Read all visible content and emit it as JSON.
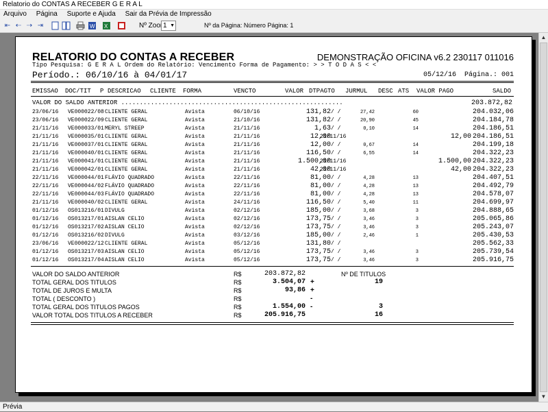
{
  "window": {
    "title": "Relatorio do CONTAS A RECEBER G E R A L"
  },
  "menu": [
    "Arquivo",
    "Página",
    "Suporte e Ajuda",
    "Sair da Prévia de Impressão"
  ],
  "toolbar": {
    "zoom_label": "Nº Zoom",
    "zoom_value": "1",
    "page_label": "Nº da Página: Número Página: 1",
    "icons": [
      "first-page-icon",
      "prev-page-icon",
      "next-page-icon",
      "last-page-icon",
      "single-page-icon",
      "two-pages-icon",
      "print-icon",
      "word-export-icon",
      "excel-export-icon",
      "pdf-export-icon"
    ]
  },
  "status": {
    "text": "Prévia"
  },
  "report": {
    "title": "RELATORIO DO CONTAS A RECEBER",
    "version": "DEMONSTRAÇÃO OFICINA v6.2 230117 011016",
    "filter": "Tipo Pesquisa: G E R A L   Ordem do Relatório: Vencimento  Forma de Pagamento: > > T O D A S < <",
    "periodo": "Período.: 06/10/16 à 04/01/17",
    "date": "05/12/16",
    "page": "Página.: 001",
    "columns": {
      "emissao": "EMISSAO",
      "doc": "DOC/TIT",
      "p": "P",
      "descricao": "DESCRICAO",
      "cliente": "CLIENTE",
      "forma": "FORMA",
      "vencto": "VENCTO",
      "valor": "VALOR",
      "dtpagto": "DTPAGTO",
      "jurmul": "JURMUL",
      "desc": "DESC",
      "ats": "ATS",
      "valor_pago": "VALOR PAGO",
      "saldo": "SALDO"
    },
    "saldo_anterior_label": "VALOR DO SALDO ANTERIOR ............................................................",
    "saldo_anterior_value": "203.872,82",
    "rows": [
      {
        "em": "23/06/16",
        "doc": "VE000022/08",
        "cli": "CLIENTE GERAL",
        "forma": "Avista",
        "venc": "06/10/16",
        "valor": "131,82",
        "dt": "/  /",
        "jur": "27,42",
        "ats": "60",
        "pago": "",
        "saldo": "204.032,06"
      },
      {
        "em": "23/06/16",
        "doc": "VE000022/09",
        "cli": "CLIENTE GERAL",
        "forma": "Avista",
        "venc": "21/10/16",
        "valor": "131,82",
        "dt": "/  /",
        "jur": "20,90",
        "ats": "45",
        "pago": "",
        "saldo": "204.184,78"
      },
      {
        "em": "21/11/16",
        "doc": "VE000033/01",
        "cli": "MERYL STREEP",
        "forma": "Avista",
        "venc": "21/11/16",
        "valor": "1,63",
        "dt": "/  /",
        "jur": "0,10",
        "ats": "14",
        "pago": "",
        "saldo": "204.186,51"
      },
      {
        "em": "21/11/16",
        "doc": "VE000035/01",
        "cli": "CLIENTE GERAL",
        "forma": "Avista",
        "venc": "21/11/16",
        "valor": "12,00",
        "dt": "21/11/16",
        "jur": "",
        "ats": "",
        "pago": "12,00",
        "saldo": "204.186,51"
      },
      {
        "em": "21/11/16",
        "doc": "VE000037/01",
        "cli": "CLIENTE GERAL",
        "forma": "Avista",
        "venc": "21/11/16",
        "valor": "12,00",
        "dt": "/  /",
        "jur": "0,67",
        "ats": "14",
        "pago": "",
        "saldo": "204.199,18"
      },
      {
        "em": "21/11/16",
        "doc": "VE000040/01",
        "cli": "CLIENTE GERAL",
        "forma": "Avista",
        "venc": "21/11/16",
        "valor": "116,50",
        "dt": "/  /",
        "jur": "6,55",
        "ats": "14",
        "pago": "",
        "saldo": "204.322,23"
      },
      {
        "em": "21/11/16",
        "doc": "VE000041/01",
        "cli": "CLIENTE GERAL",
        "forma": "Avista",
        "venc": "21/11/16",
        "valor": "1.500,00",
        "dt": "21/11/16",
        "jur": "",
        "ats": "",
        "pago": "1.500,00",
        "saldo": "204.322,23"
      },
      {
        "em": "21/11/16",
        "doc": "VE000042/01",
        "cli": "CLIENTE GERAL",
        "forma": "Avista",
        "venc": "21/11/16",
        "valor": "42,00",
        "dt": "21/11/16",
        "jur": "",
        "ats": "",
        "pago": "42,00",
        "saldo": "204.322,23"
      },
      {
        "em": "22/11/16",
        "doc": "VE000044/01",
        "cli": "FLÁVIO QUADRADO",
        "forma": "Avista",
        "venc": "22/11/16",
        "valor": "81,00",
        "dt": "/  /",
        "jur": "4,28",
        "ats": "13",
        "pago": "",
        "saldo": "204.407,51"
      },
      {
        "em": "22/11/16",
        "doc": "VE000044/02",
        "cli": "FLÁVIO QUADRADO",
        "forma": "Avista",
        "venc": "22/11/16",
        "valor": "81,00",
        "dt": "/  /",
        "jur": "4,28",
        "ats": "13",
        "pago": "",
        "saldo": "204.492,79"
      },
      {
        "em": "22/11/16",
        "doc": "VE000044/03",
        "cli": "FLÁVIO QUADRADO",
        "forma": "Avista",
        "venc": "22/11/16",
        "valor": "81,00",
        "dt": "/  /",
        "jur": "4,28",
        "ats": "13",
        "pago": "",
        "saldo": "204.578,07"
      },
      {
        "em": "21/11/16",
        "doc": "VE000040/02",
        "cli": "CLIENTE GERAL",
        "forma": "Avista",
        "venc": "24/11/16",
        "valor": "116,50",
        "dt": "/  /",
        "jur": "5,40",
        "ats": "11",
        "pago": "",
        "saldo": "204.699,97"
      },
      {
        "em": "01/12/16",
        "doc": "OS013216/01",
        "cli": "DIVULG",
        "forma": "Avista",
        "venc": "02/12/16",
        "valor": "185,00",
        "dt": "/  /",
        "jur": "3,68",
        "ats": "3",
        "pago": "",
        "saldo": "204.888,65"
      },
      {
        "em": "01/12/16",
        "doc": "OS013217/01",
        "cli": "AISLAN CELIO",
        "forma": "Avista",
        "venc": "02/12/16",
        "valor": "173,75",
        "dt": "/  /",
        "jur": "3,46",
        "ats": "3",
        "pago": "",
        "saldo": "205.065,86"
      },
      {
        "em": "01/12/16",
        "doc": "OS013217/02",
        "cli": "AISLAN CELIO",
        "forma": "Avista",
        "venc": "02/12/16",
        "valor": "173,75",
        "dt": "/  /",
        "jur": "3,46",
        "ats": "3",
        "pago": "",
        "saldo": "205.243,07"
      },
      {
        "em": "01/12/16",
        "doc": "OS013216/02",
        "cli": "DIVULG",
        "forma": "Avista",
        "venc": "03/12/16",
        "valor": "185,00",
        "dt": "/  /",
        "jur": "2,46",
        "ats": "1",
        "pago": "",
        "saldo": "205.430,53"
      },
      {
        "em": "23/06/16",
        "doc": "VE000022/12",
        "cli": "CLIENTE GERAL",
        "forma": "Avista",
        "venc": "05/12/16",
        "valor": "131,80",
        "dt": "/  /",
        "jur": "",
        "ats": "",
        "pago": "",
        "saldo": "205.562,33"
      },
      {
        "em": "01/12/16",
        "doc": "OS013217/03",
        "cli": "AISLAN CELIO",
        "forma": "Avista",
        "venc": "05/12/16",
        "valor": "173,75",
        "dt": "/  /",
        "jur": "3,46",
        "ats": "3",
        "pago": "",
        "saldo": "205.739,54"
      },
      {
        "em": "01/12/16",
        "doc": "OS013217/04",
        "cli": "AISLAN CELIO",
        "forma": "Avista",
        "venc": "05/12/16",
        "valor": "173,75",
        "dt": "/  /",
        "jur": "3,46",
        "ats": "3",
        "pago": "",
        "saldo": "205.916,75"
      }
    ],
    "totals": {
      "saldo_anterior_label": "VALOR DO SALDO ANTERIOR",
      "saldo_anterior_cur": "R$",
      "saldo_anterior_value": "203.872,82",
      "n_titulos_label": "Nº DE TITULOS",
      "geral_label": "TOTAL GERAL DOS TITULOS",
      "geral_cur": "R$",
      "geral_value": "3.504,07",
      "geral_sign": "+",
      "geral_count": "19",
      "juros_label": "TOTAL DE JUROS E MULTA",
      "juros_cur": "R$",
      "juros_value": "93,86",
      "juros_sign": "+",
      "desconto_label": "TOTAL ( DESCONTO )",
      "desconto_cur": "R$",
      "desconto_sign": "-",
      "pagos_label": "TOTAL GERAL DOS TITULOS PAGOS",
      "pagos_cur": "R$",
      "pagos_value": "1.554,00",
      "pagos_sign": "-",
      "pagos_count": "3",
      "receber_label": "VALOR TOTAL DOS TITULOS A RECEBER",
      "receber_cur": "R$",
      "receber_value": "205.916,75",
      "receber_count": "16"
    }
  }
}
